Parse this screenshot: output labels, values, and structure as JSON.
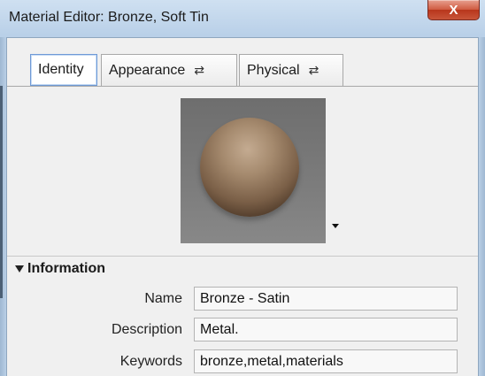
{
  "window": {
    "title": "Material Editor: Bronze, Soft Tin",
    "close_glyph": "X"
  },
  "tabs": [
    {
      "label": "Identity",
      "selected": true,
      "has_swap_icon": false
    },
    {
      "label": "Appearance",
      "selected": false,
      "has_swap_icon": true
    },
    {
      "label": "Physical",
      "selected": false,
      "has_swap_icon": true
    }
  ],
  "icons": {
    "swap": "⇄",
    "dropdown": "chevron-down-icon",
    "section_toggle": "triangle-down-icon"
  },
  "information": {
    "header": "Information",
    "fields": [
      {
        "label": "Name",
        "value": "Bronze - Satin"
      },
      {
        "label": "Description",
        "value": "Metal."
      },
      {
        "label": "Keywords",
        "value": "bronze,metal,materials"
      }
    ]
  },
  "colors": {
    "title_bar": "#cfe0f1",
    "close_button": "#c8553a",
    "selected_tab_border": "#6f9ad6",
    "sphere_bronze": "#a58a6e"
  }
}
